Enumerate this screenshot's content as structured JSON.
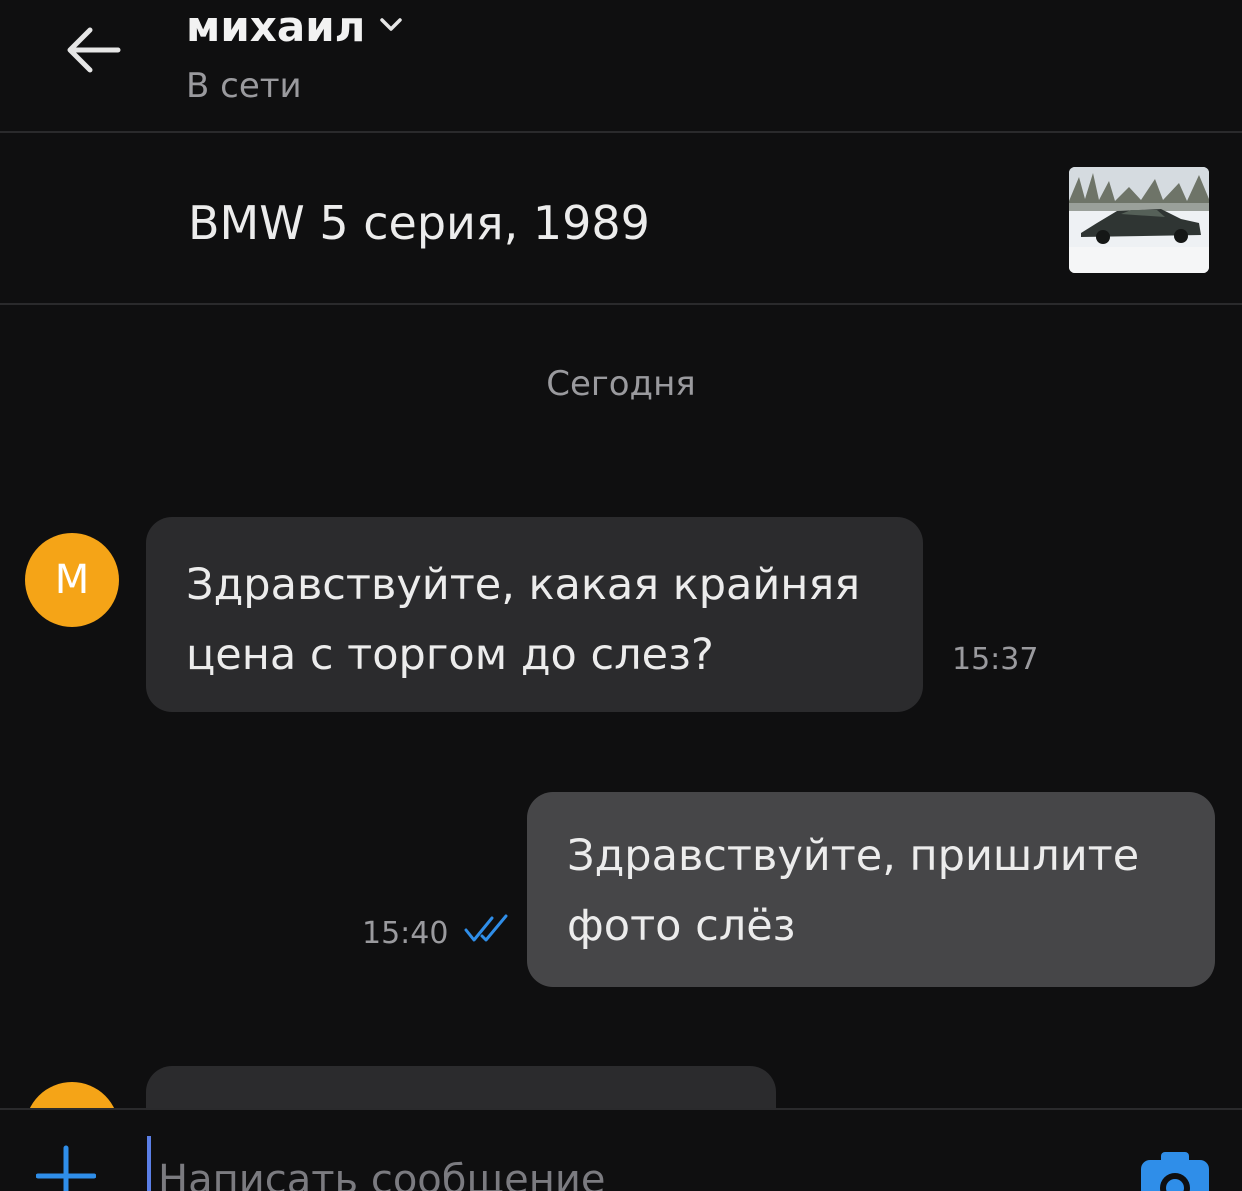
{
  "header": {
    "contact_name": "михаил",
    "status": "В сети"
  },
  "listing": {
    "title": "BMW 5 серия, 1989"
  },
  "chat": {
    "date_separator": "Сегодня",
    "messages": [
      {
        "direction": "incoming",
        "avatar_letter": "М",
        "lines": [
          "Здравствуйте, какая крайняя",
          "цена с торгом до слез?"
        ],
        "time": "15:37"
      },
      {
        "direction": "outgoing",
        "lines": [
          "Здравствуйте, пришлите",
          "фото слёз"
        ],
        "time": "15:40",
        "read_icon": "double-check-icon"
      }
    ]
  },
  "composer": {
    "placeholder": "Написать сообщение"
  },
  "colors": {
    "background": "#0f0f10",
    "incoming_bubble": "#2b2b2d",
    "outgoing_bubble": "#464648",
    "avatar": "#f5a417",
    "accent": "#2f8ee9",
    "muted_text": "#9a9a9e"
  }
}
